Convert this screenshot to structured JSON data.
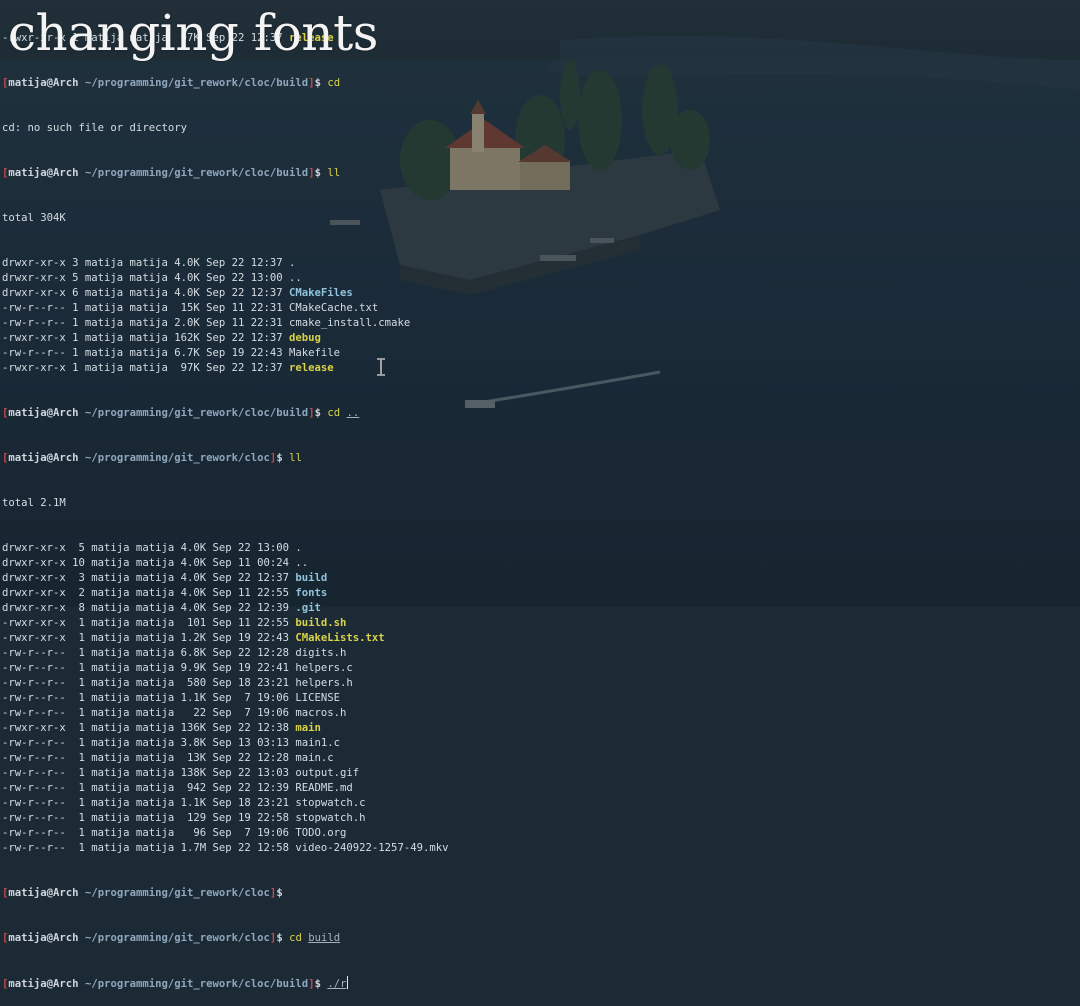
{
  "overlay_title": "changing fonts",
  "prompt": {
    "user": "matija@Arch",
    "path_cloc": "~/programming/git_rework/cloc",
    "path_build": "~/programming/git_rework/cloc/build"
  },
  "scrollback": {
    "top_line": "-rwxr-xr-x 1 matija matija  97K Sep 22 12:37 ",
    "top_line_name": "release",
    "error_line": "cd: no such file or directory"
  },
  "listing1": {
    "total": "total 304K",
    "rows": [
      {
        "meta": "drwxr-xr-x 3 matija matija 4.0K Sep 22 12:37 ",
        "name": ".",
        "kind": "plain"
      },
      {
        "meta": "drwxr-xr-x 5 matija matija 4.0K Sep 22 13:00 ",
        "name": "..",
        "kind": "plain"
      },
      {
        "meta": "drwxr-xr-x 6 matija matija 4.0K Sep 22 12:37 ",
        "name": "CMakeFiles",
        "kind": "dir"
      },
      {
        "meta": "-rw-r--r-- 1 matija matija  15K Sep 11 22:31 ",
        "name": "CMakeCache.txt",
        "kind": "plain"
      },
      {
        "meta": "-rw-r--r-- 1 matija matija 2.0K Sep 11 22:31 ",
        "name": "cmake_install.cmake",
        "kind": "plain"
      },
      {
        "meta": "-rwxr-xr-x 1 matija matija 162K Sep 22 12:37 ",
        "name": "debug",
        "kind": "exe"
      },
      {
        "meta": "-rw-r--r-- 1 matija matija 6.7K Sep 19 22:43 ",
        "name": "Makefile",
        "kind": "plain"
      },
      {
        "meta": "-rwxr-xr-x 1 matija matija  97K Sep 22 12:37 ",
        "name": "release",
        "kind": "exe"
      }
    ]
  },
  "listing2": {
    "total": "total 2.1M",
    "rows": [
      {
        "meta": "drwxr-xr-x  5 matija matija 4.0K Sep 22 13:00 ",
        "name": ".",
        "kind": "plain"
      },
      {
        "meta": "drwxr-xr-x 10 matija matija 4.0K Sep 11 00:24 ",
        "name": "..",
        "kind": "plain"
      },
      {
        "meta": "drwxr-xr-x  3 matija matija 4.0K Sep 22 12:37 ",
        "name": "build",
        "kind": "dir"
      },
      {
        "meta": "drwxr-xr-x  2 matija matija 4.0K Sep 11 22:55 ",
        "name": "fonts",
        "kind": "dir"
      },
      {
        "meta": "drwxr-xr-x  8 matija matija 4.0K Sep 22 12:39 ",
        "name": ".git",
        "kind": "dir"
      },
      {
        "meta": "-rwxr-xr-x  1 matija matija  101 Sep 11 22:55 ",
        "name": "build.sh",
        "kind": "exe"
      },
      {
        "meta": "-rwxr-xr-x  1 matija matija 1.2K Sep 19 22:43 ",
        "name": "CMakeLists.txt",
        "kind": "exe"
      },
      {
        "meta": "-rw-r--r--  1 matija matija 6.8K Sep 22 12:28 ",
        "name": "digits.h",
        "kind": "plain"
      },
      {
        "meta": "-rw-r--r--  1 matija matija 9.9K Sep 19 22:41 ",
        "name": "helpers.c",
        "kind": "plain"
      },
      {
        "meta": "-rw-r--r--  1 matija matija  580 Sep 18 23:21 ",
        "name": "helpers.h",
        "kind": "plain"
      },
      {
        "meta": "-rw-r--r--  1 matija matija 1.1K Sep  7 19:06 ",
        "name": "LICENSE",
        "kind": "plain"
      },
      {
        "meta": "-rw-r--r--  1 matija matija   22 Sep  7 19:06 ",
        "name": "macros.h",
        "kind": "plain"
      },
      {
        "meta": "-rwxr-xr-x  1 matija matija 136K Sep 22 12:38 ",
        "name": "main",
        "kind": "exe"
      },
      {
        "meta": "-rw-r--r--  1 matija matija 3.8K Sep 13 03:13 ",
        "name": "main1.c",
        "kind": "plain"
      },
      {
        "meta": "-rw-r--r--  1 matija matija  13K Sep 22 12:28 ",
        "name": "main.c",
        "kind": "plain"
      },
      {
        "meta": "-rw-r--r--  1 matija matija 138K Sep 22 13:03 ",
        "name": "output.gif",
        "kind": "plain"
      },
      {
        "meta": "-rw-r--r--  1 matija matija  942 Sep 22 12:39 ",
        "name": "README.md",
        "kind": "plain"
      },
      {
        "meta": "-rw-r--r--  1 matija matija 1.1K Sep 18 23:21 ",
        "name": "stopwatch.c",
        "kind": "plain"
      },
      {
        "meta": "-rw-r--r--  1 matija matija  129 Sep 19 22:58 ",
        "name": "stopwatch.h",
        "kind": "plain"
      },
      {
        "meta": "-rw-r--r--  1 matija matija   96 Sep  7 19:06 ",
        "name": "TODO.org",
        "kind": "plain"
      },
      {
        "meta": "-rw-r--r--  1 matija matija 1.7M Sep 22 12:58 ",
        "name": "video-240922-1257-49.mkv",
        "kind": "plain"
      }
    ]
  },
  "commands": {
    "ll": "ll",
    "cd": "cd",
    "cd_up_arg": "..",
    "cd_build_arg": "build",
    "current_input": "./r"
  },
  "colors": {
    "directory": "#8fc4dc",
    "executable": "#d8d24a",
    "prompt_bracket": "#c04a4a",
    "text": "#d5dde3"
  }
}
